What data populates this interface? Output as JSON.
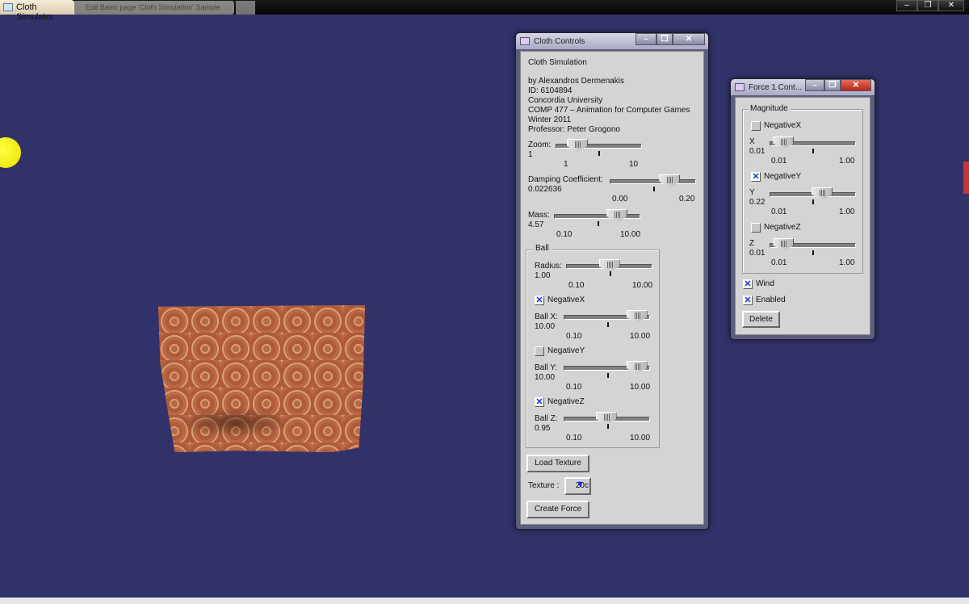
{
  "app": {
    "title": "Cloth Simulator",
    "ghost_tab": "Edit Basic page 'Cloth Simulation' Sample",
    "window_controls": {
      "minimize": "–",
      "maximize": "❐",
      "close": "✕"
    }
  },
  "colors": {
    "background": "#32326a",
    "ball": "#ffff30",
    "panel": "#d4d4d4",
    "check": "#1133cc"
  },
  "cloth_controls": {
    "title": "Cloth Controls",
    "info": [
      "Cloth Simulation",
      "by Alexandros Dermenakis",
      "ID: 6104894",
      "Concordia University",
      "COMP 477 – Animation for Computer Games",
      "Winter 2011",
      "Professor: Peter Grogono"
    ],
    "sliders": [
      {
        "id": "zoom",
        "label": "Zoom:",
        "value": "1",
        "min": "1",
        "max": "10",
        "level": 0.22
      },
      {
        "id": "damping",
        "label": "Damping Coefficient:",
        "value": "0.022636",
        "min": "0.00",
        "max": "0.20",
        "level": 0.72
      },
      {
        "id": "mass",
        "label": "Mass:",
        "value": "4.57",
        "min": "0.10",
        "max": "10.00",
        "level": 0.76
      }
    ],
    "ball": {
      "legend": "Ball",
      "sliders": [
        {
          "id": "radius",
          "label": "Radius:",
          "value": "1.00",
          "min": "0.10",
          "max": "10.00",
          "level": 0.5
        },
        {
          "id": "ballx",
          "label": "Ball X:",
          "value": "10.00",
          "min": "0.10",
          "max": "10.00",
          "level": 0.89
        },
        {
          "id": "bally",
          "label": "Ball Y:",
          "value": "10.00",
          "min": "0.10",
          "max": "10.00",
          "level": 0.89
        },
        {
          "id": "ballz",
          "label": "Ball Z:",
          "value": "0.95",
          "min": "0.10",
          "max": "10.00",
          "level": 0.49
        }
      ],
      "checkboxes": [
        {
          "id": "negx",
          "label": "NegativeX",
          "checked": true
        },
        {
          "id": "negy",
          "label": "NegativeY",
          "checked": false
        },
        {
          "id": "negz",
          "label": "NegativeZ",
          "checked": true
        }
      ]
    },
    "load_texture": "Load Texture",
    "texture_label": "Texture :",
    "texture_value": "20c",
    "create_force": "Create Force"
  },
  "force_controls": {
    "title": "Force 1 Cont...",
    "legend": "Magnitude",
    "sliders": [
      {
        "id": "fx",
        "label": "X",
        "value": "0.01",
        "min": "0.01",
        "max": "1.00",
        "level": 0.12
      },
      {
        "id": "fy",
        "label": "Y",
        "value": "0.22",
        "min": "0.01",
        "max": "1.00",
        "level": 0.62
      },
      {
        "id": "fz",
        "label": "Z",
        "value": "0.01",
        "min": "0.01",
        "max": "1.00",
        "level": 0.12
      }
    ],
    "checkboxes": [
      {
        "id": "fnegx",
        "label": "NegativeX",
        "checked": false
      },
      {
        "id": "fnegy",
        "label": "NegativeY",
        "checked": true
      },
      {
        "id": "fnegz",
        "label": "NegativeZ",
        "checked": false
      },
      {
        "id": "wind",
        "label": "Wind",
        "checked": true
      },
      {
        "id": "enabled",
        "label": "Enabled",
        "checked": true
      }
    ],
    "delete": "Delete"
  }
}
